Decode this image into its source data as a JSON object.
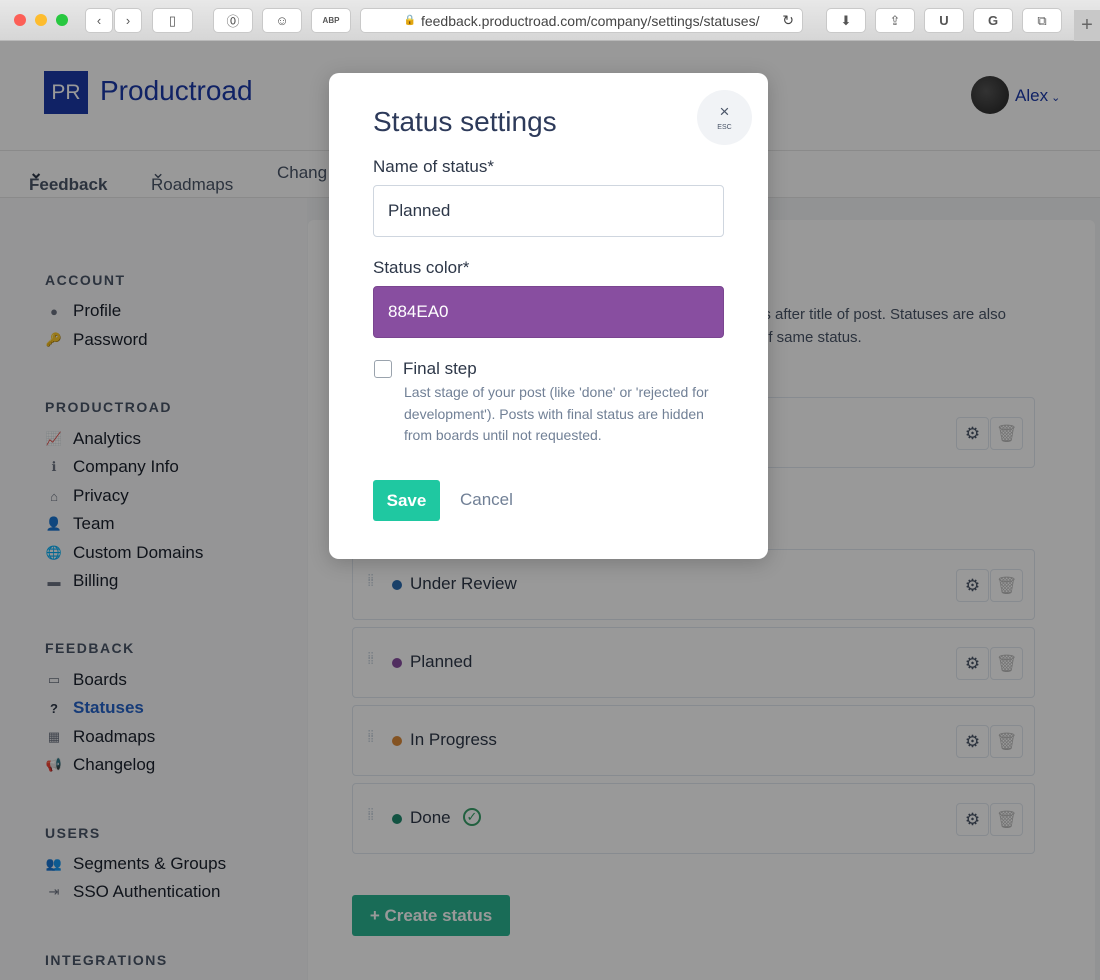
{
  "browser": {
    "url": "feedback.productroad.com/company/settings/statuses/",
    "ext_labels": [
      "ABP",
      "U",
      "G"
    ]
  },
  "header": {
    "logo": "PR",
    "brand": "Productroad",
    "user": "Alex"
  },
  "nav": [
    "Feedback",
    "Roadmaps",
    "Chang"
  ],
  "sidebar": {
    "account": {
      "title": "ACCOUNT",
      "items": [
        "Profile",
        "Password"
      ]
    },
    "productroad": {
      "title": "PRODUCTROAD",
      "items": [
        "Analytics",
        "Company Info",
        "Privacy",
        "Team",
        "Custom Domains",
        "Billing"
      ]
    },
    "feedback": {
      "title": "FEEDBACK",
      "items": [
        "Boards",
        "Statuses",
        "Roadmaps",
        "Changelog"
      ]
    },
    "users": {
      "title": "USERS",
      "items": [
        "Segments & Groups",
        "SSO Authentication"
      ]
    },
    "integrations": {
      "title": "INTEGRATIONS"
    }
  },
  "main": {
    "desc1": "ls after title of post. Statuses are also",
    "desc2": "of same status.",
    "statuses": [
      {
        "name": "Under Review",
        "color": "#2b6cb0"
      },
      {
        "name": "Planned",
        "color": "#884EA0"
      },
      {
        "name": "In Progress",
        "color": "#dd8a3a"
      },
      {
        "name": "Done",
        "color": "#1e8a6e",
        "final": true
      }
    ],
    "create_label": "+ Create status"
  },
  "modal": {
    "title": "Status settings",
    "close": "×",
    "esc": "ESC",
    "name_label": "Name of status*",
    "name_value": "Planned",
    "color_label": "Status color*",
    "color_value": "884EA0",
    "color_hex": "#884EA0",
    "final_label": "Final step",
    "final_checked": false,
    "final_help": "Last stage of your post (like 'done' or 'rejected for development'). Posts with final status are hidden from boards until not requested.",
    "save": "Save",
    "cancel": "Cancel"
  }
}
